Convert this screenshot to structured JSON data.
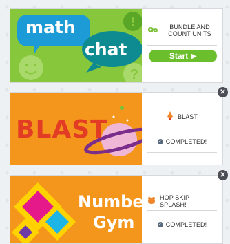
{
  "colors": {
    "green_art": "#86c73b",
    "orange_art": "#f5961c",
    "start_button": "#6cbf2c",
    "close_button": "#4b4f55"
  },
  "cards": [
    {
      "art_line1": "math",
      "art_line2": "chat",
      "activity_label": "BUNDLE AND COUNT UNITS",
      "activity_icon": "gears-icon",
      "button_label": "Start"
    },
    {
      "art_title": "BLAST",
      "activity_label": "BLAST",
      "activity_icon": "rocket-icon",
      "status": "COMPLETED!"
    },
    {
      "art_line1": "Number",
      "art_line2": "Gym",
      "activity_label": "HOP SKIP SPLASH!",
      "activity_icon": "frog-icon",
      "status": "COMPLETED!"
    }
  ]
}
